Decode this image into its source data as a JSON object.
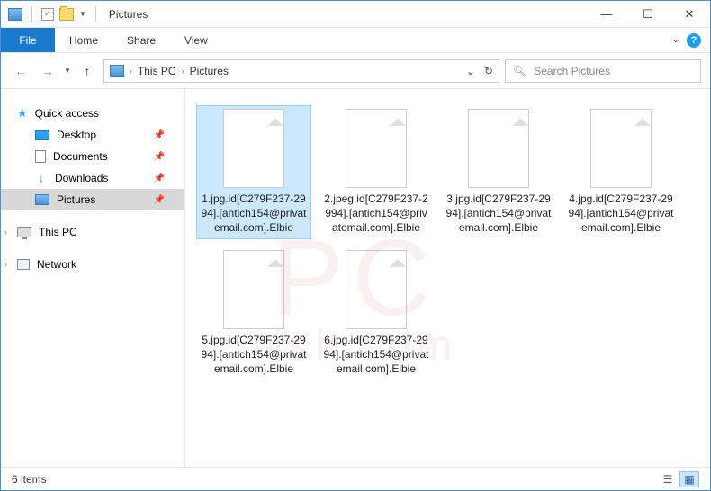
{
  "titlebar": {
    "title": "Pictures"
  },
  "ribbon": {
    "file": "File",
    "tabs": [
      "Home",
      "Share",
      "View"
    ]
  },
  "breadcrumb": {
    "items": [
      "This PC",
      "Pictures"
    ]
  },
  "search": {
    "placeholder": "Search Pictures"
  },
  "sidebar": {
    "quick_access": "Quick access",
    "items": [
      {
        "label": "Desktop"
      },
      {
        "label": "Documents"
      },
      {
        "label": "Downloads"
      },
      {
        "label": "Pictures"
      }
    ],
    "this_pc": "This PC",
    "network": "Network"
  },
  "files": [
    {
      "name": "1.jpg.id[C279F237-2994].[antich154@privatemail.com].Elbie",
      "selected": true
    },
    {
      "name": "2.jpeg.id[C279F237-2994].[antich154@privatemail.com].Elbie",
      "selected": false
    },
    {
      "name": "3.jpg.id[C279F237-2994].[antich154@privatemail.com].Elbie",
      "selected": false
    },
    {
      "name": "4.jpg.id[C279F237-2994].[antich154@privatemail.com].Elbie",
      "selected": false
    },
    {
      "name": "5.jpg.id[C279F237-2994].[antich154@privatemail.com].Elbie",
      "selected": false
    },
    {
      "name": "6.jpg.id[C279F237-2994].[antich154@privatemail.com].Elbie",
      "selected": false
    }
  ],
  "statusbar": {
    "count_label": "6 items"
  },
  "watermark": {
    "main": "PC",
    "sub": "risk.com"
  }
}
